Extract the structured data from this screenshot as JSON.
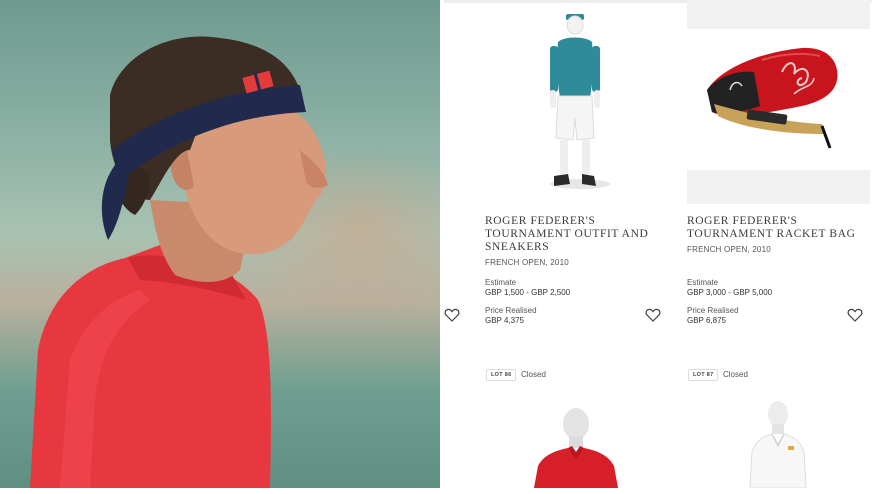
{
  "lots": [
    {
      "title": "ROGER FEDERER'S TOURNAMENT OUTFIT AND SNEAKERS",
      "subtitle": "FRENCH OPEN, 2010",
      "estimate_label": "Estimate",
      "estimate_value": "GBP 1,500 - GBP 2,500",
      "realised_label": "Price Realised",
      "realised_value": "GBP 4,375",
      "image": "tennis-outfit-mannequin"
    },
    {
      "title": "ROGER FEDERER'S TOURNAMENT RACKET BAG",
      "subtitle": "FRENCH OPEN, 2010",
      "estimate_label": "Estimate",
      "estimate_value": "GBP 3,000 - GBP 5,000",
      "realised_label": "Price Realised",
      "realised_value": "GBP 6,875",
      "image": "red-racket-bag"
    }
  ],
  "next_lots": [
    {
      "lot": "LOT 86",
      "status": "Closed",
      "image": "red-polo-mannequin"
    },
    {
      "lot": "LOT 87",
      "status": "Closed",
      "image": "white-polo-mannequin"
    }
  ],
  "icons": {
    "favorite": "heart-outline-icon"
  },
  "colors": {
    "shirt_red": "#e8383f",
    "headband_navy": "#1f2a4d",
    "outfit_teal": "#2f8a99",
    "bag_red": "#c8141c"
  }
}
